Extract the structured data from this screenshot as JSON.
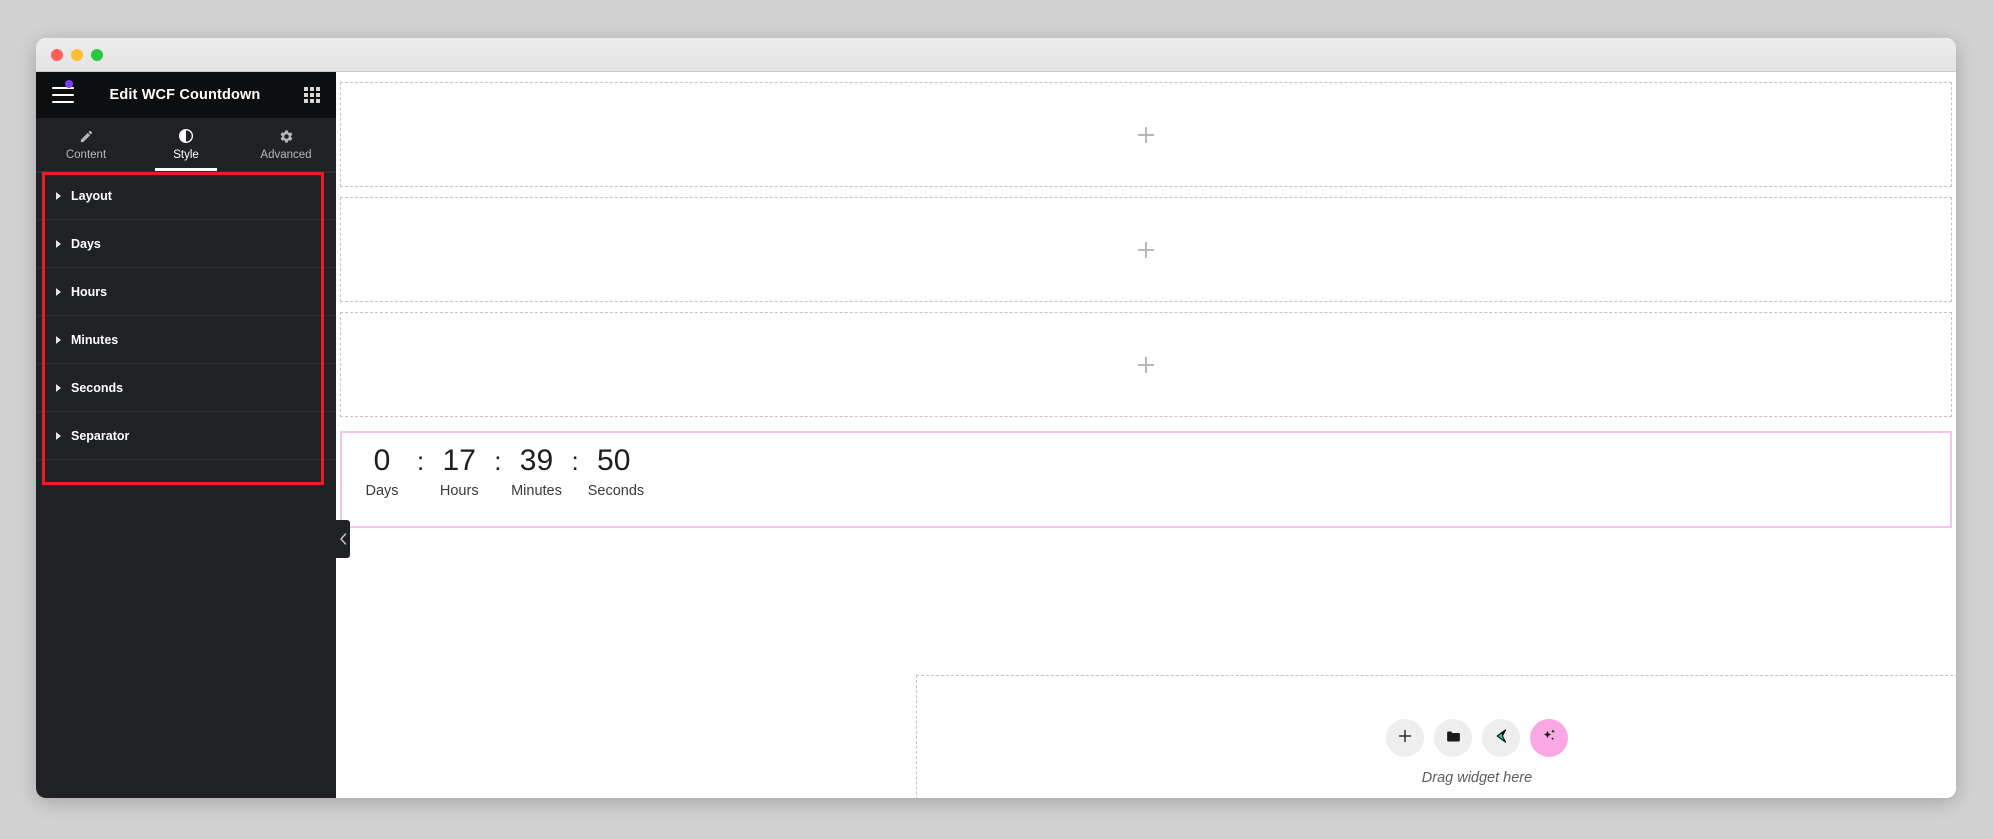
{
  "window": {
    "traffic_lights": [
      {
        "name": "close",
        "color": "#ff5f57"
      },
      {
        "name": "minimize",
        "color": "#febc2e"
      },
      {
        "name": "maximize",
        "color": "#28c840"
      }
    ]
  },
  "panel": {
    "title": "Edit WCF Countdown",
    "menu_icon": "hamburger-menu-icon",
    "notification_dot_color": "#7a3df5",
    "apps_grid_icon": "apps-grid-icon",
    "tabs": [
      {
        "label": "Content",
        "icon": "pencil-icon",
        "active": false
      },
      {
        "label": "Style",
        "icon": "contrast-icon",
        "active": true
      },
      {
        "label": "Advanced",
        "icon": "gear-icon",
        "active": false
      }
    ],
    "sections": [
      {
        "label": "Layout",
        "expanded": false
      },
      {
        "label": "Days",
        "expanded": false
      },
      {
        "label": "Hours",
        "expanded": false
      },
      {
        "label": "Minutes",
        "expanded": false
      },
      {
        "label": "Seconds",
        "expanded": false
      },
      {
        "label": "Separator",
        "expanded": false
      }
    ],
    "annotation_color": "#ed1c24",
    "collapse_icon": "chevron-left-icon"
  },
  "canvas": {
    "empty_sections": [
      {
        "add_icon": "plus-icon"
      },
      {
        "add_icon": "plus-icon"
      },
      {
        "add_icon": "plus-icon"
      }
    ],
    "countdown": {
      "selection_color": "#f3c6ef",
      "separator": ":",
      "units": [
        {
          "value": "0",
          "label": "Days"
        },
        {
          "value": "17",
          "label": "Hours"
        },
        {
          "value": "39",
          "label": "Minutes"
        },
        {
          "value": "50",
          "label": "Seconds"
        }
      ]
    },
    "drop_zone": {
      "caption": "Drag widget here",
      "buttons": [
        {
          "name": "add-element-button",
          "icon": "plus-icon",
          "glyph": "+"
        },
        {
          "name": "add-template-button",
          "icon": "folder-icon",
          "glyph": "folder"
        },
        {
          "name": "elementor-ai-button",
          "icon": "elementor-logo-icon",
          "glyph": "elementor"
        },
        {
          "name": "ai-generate-button",
          "icon": "sparkles-icon",
          "glyph": "sparkles",
          "accent": "#f9a8e4"
        }
      ]
    }
  }
}
